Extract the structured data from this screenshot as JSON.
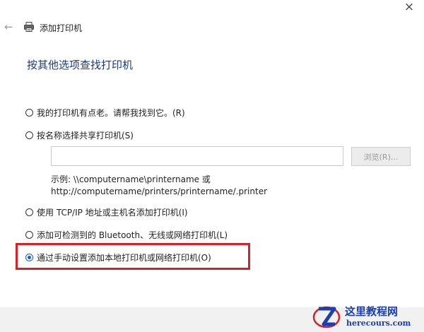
{
  "window": {
    "close_glyph": "×",
    "back_glyph": "←",
    "title": "添加打印机"
  },
  "heading": "按其他选项查找打印机",
  "options": [
    {
      "label": "我的打印机有点老。请帮我找到它。(R)",
      "checked": false
    },
    {
      "label": "按名称选择共享打印机(S)",
      "checked": false
    },
    {
      "label": "使用 TCP/IP 地址或主机名添加打印机(I)",
      "checked": false
    },
    {
      "label": "添加可检测到的 Bluetooth、无线或网络打印机(L)",
      "checked": false
    },
    {
      "label": "通过手动设置添加本地打印机或网络打印机(O)",
      "checked": true
    }
  ],
  "shared_printer": {
    "input_value": "",
    "browse_label": "浏览(R)...",
    "example_line1": "示例: \\\\computername\\printername 或",
    "example_line2": "http://computername/printers/printername/.printer"
  },
  "watermark": {
    "site_name": "这里教程网",
    "site_url": "herecours.com"
  },
  "colors": {
    "heading": "#1e3a78",
    "highlight": "#d0232a",
    "radio_checked": "#1a5fb4",
    "watermark": "#1b3fae"
  },
  "icons": {
    "back": "back-arrow-icon",
    "printer": "printer-icon",
    "close": "close-icon"
  }
}
